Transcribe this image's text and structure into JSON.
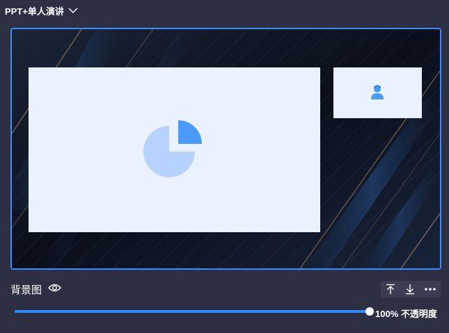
{
  "layout_selector": {
    "label": "PPT+单人演讲",
    "icon": "chevron-down-icon"
  },
  "preview": {
    "slide_placeholder_icon": "pie-chart-icon",
    "speaker_placeholder_icon": "person-icon",
    "accent_color": "#3a8cff",
    "placeholder_color": "#eaf2ff"
  },
  "background": {
    "label": "背景图",
    "visibility_icon": "eye-icon",
    "toolbar": {
      "move_top_icon": "move-to-top-icon",
      "move_bottom_icon": "move-to-bottom-icon",
      "more_icon": "more-icon"
    }
  },
  "opacity": {
    "value_fraction": 1.0,
    "value_label": "100%",
    "label": "不透明度"
  }
}
